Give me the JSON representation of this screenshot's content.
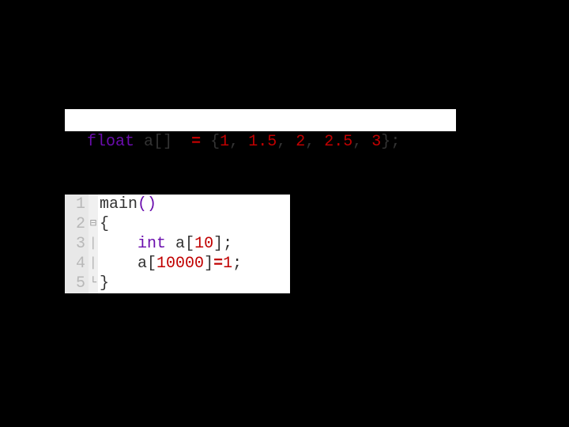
{
  "snippet1": {
    "type_kw": "float",
    "sp1": " ",
    "ident": "a",
    "brk_open": "[",
    "brk_close": "]",
    "sp2": "  ",
    "assign": "=",
    "sp3": " ",
    "brace_open": "{",
    "n1": "1",
    "c1": ", ",
    "n2": "1.5",
    "c2": ", ",
    "n3": "2",
    "c3": ", ",
    "n4": "2.5",
    "c4": ", ",
    "n5": "3",
    "brace_close": "}",
    "semi": ";"
  },
  "snippet2": {
    "lines": {
      "l1": {
        "num": "1",
        "fold": " ",
        "func": "main",
        "lp": "(",
        "rp": ")"
      },
      "l2": {
        "num": "2",
        "fold": "⊟",
        "brace": "{"
      },
      "l3": {
        "num": "3",
        "fold": "│",
        "indent": "    ",
        "type_kw": "int",
        "sp": " ",
        "ident": "a",
        "bo": "[",
        "n": "10",
        "bc": "]",
        "semi": ";"
      },
      "l4": {
        "num": "4",
        "fold": "│",
        "indent": "    ",
        "ident": "a",
        "bo": "[",
        "n": "10000",
        "bc": "]",
        "assign": "=",
        "v": "1",
        "semi": ";"
      },
      "l5": {
        "num": "5",
        "fold": "└",
        "brace": "}"
      }
    }
  }
}
